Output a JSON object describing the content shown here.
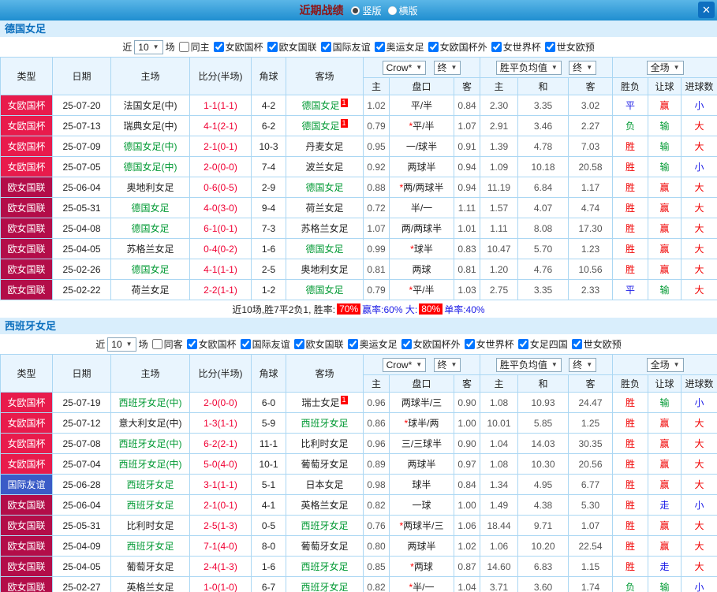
{
  "topbar": {
    "title": "近期战绩",
    "radios": [
      {
        "label": "竖版",
        "selected": true
      },
      {
        "label": "横版",
        "selected": false
      }
    ],
    "close_label": "✕"
  },
  "table_header": {
    "static_cols": [
      "类型",
      "日期",
      "主场",
      "比分(半场)",
      "角球",
      "客场"
    ],
    "odds_group": {
      "select1": "Crow*",
      "select2": "终",
      "cols": [
        "主",
        "盘口",
        "客"
      ]
    },
    "avg_group": {
      "select1": "胜平负均值",
      "select2": "终",
      "cols": [
        "主",
        "和",
        "客"
      ]
    },
    "result_group": {
      "select1": "全场",
      "cols": [
        "胜负",
        "让球",
        "进球数"
      ]
    }
  },
  "colors": {
    "cup": "#e81b4c",
    "nations": "#b30d49",
    "friendly": "#3a5bc7",
    "focal_team": "#009933",
    "score": "#f00033",
    "header_blue": "#0a6ebd"
  },
  "result_colors": {
    "胜": "#f00000",
    "赢": "#f00000",
    "大": "#f00000",
    "平": "#1a1ae6",
    "走": "#1a1ae6",
    "小": "#1a1ae6",
    "负": "#009933",
    "输": "#009933"
  },
  "sections": [
    {
      "team": "德国女足",
      "filter": {
        "prefix": "近",
        "count": "10",
        "suffix": "场",
        "special": {
          "label": "同主",
          "checked": false
        },
        "leagues": [
          {
            "label": "女欧国杯",
            "checked": true
          },
          {
            "label": "欧女国联",
            "checked": true
          },
          {
            "label": "国际友谊",
            "checked": true
          },
          {
            "label": "奥运女足",
            "checked": true
          },
          {
            "label": "女欧国杯外",
            "checked": true
          },
          {
            "label": "女世界杯",
            "checked": true
          },
          {
            "label": "世女欧预",
            "checked": true
          }
        ]
      },
      "rows": [
        {
          "league": "女欧国杯",
          "league_type": "cup",
          "date": "25-07-20",
          "home": "法国女足(中)",
          "home_focal": false,
          "home_badge": "",
          "score": "1-1(1-1)",
          "corners": "4-2",
          "away": "德国女足",
          "away_focal": true,
          "away_badge": "1",
          "odds": [
            "1.02",
            "平/半",
            "0.84"
          ],
          "avg": [
            "2.30",
            "3.35",
            "3.02"
          ],
          "results": [
            "平",
            "赢",
            "小"
          ]
        },
        {
          "league": "女欧国杯",
          "league_type": "cup",
          "date": "25-07-13",
          "home": "瑞典女足(中)",
          "home_focal": false,
          "home_badge": "",
          "score": "4-1(2-1)",
          "corners": "6-2",
          "away": "德国女足",
          "away_focal": true,
          "away_badge": "1",
          "odds": [
            "0.79",
            "*平/半",
            "1.07"
          ],
          "avg": [
            "2.91",
            "3.46",
            "2.27"
          ],
          "results": [
            "负",
            "输",
            "大"
          ]
        },
        {
          "league": "女欧国杯",
          "league_type": "cup",
          "date": "25-07-09",
          "home": "德国女足(中)",
          "home_focal": true,
          "home_badge": "",
          "score": "2-1(0-1)",
          "corners": "10-3",
          "away": "丹麦女足",
          "away_focal": false,
          "away_badge": "",
          "odds": [
            "0.95",
            "一/球半",
            "0.91"
          ],
          "avg": [
            "1.39",
            "4.78",
            "7.03"
          ],
          "results": [
            "胜",
            "输",
            "大"
          ]
        },
        {
          "league": "女欧国杯",
          "league_type": "cup",
          "date": "25-07-05",
          "home": "德国女足(中)",
          "home_focal": true,
          "home_badge": "",
          "score": "2-0(0-0)",
          "corners": "7-4",
          "away": "波兰女足",
          "away_focal": false,
          "away_badge": "",
          "odds": [
            "0.92",
            "两球半",
            "0.94"
          ],
          "avg": [
            "1.09",
            "10.18",
            "20.58"
          ],
          "results": [
            "胜",
            "输",
            "小"
          ]
        },
        {
          "league": "欧女国联",
          "league_type": "nations",
          "date": "25-06-04",
          "home": "奥地利女足",
          "home_focal": false,
          "home_badge": "",
          "score": "0-6(0-5)",
          "corners": "2-9",
          "away": "德国女足",
          "away_focal": true,
          "away_badge": "",
          "odds": [
            "0.88",
            "*两/两球半",
            "0.94"
          ],
          "avg": [
            "11.19",
            "6.84",
            "1.17"
          ],
          "results": [
            "胜",
            "赢",
            "大"
          ]
        },
        {
          "league": "欧女国联",
          "league_type": "nations",
          "date": "25-05-31",
          "home": "德国女足",
          "home_focal": true,
          "home_badge": "",
          "score": "4-0(3-0)",
          "corners": "9-4",
          "away": "荷兰女足",
          "away_focal": false,
          "away_badge": "",
          "odds": [
            "0.72",
            "半/一",
            "1.11"
          ],
          "avg": [
            "1.57",
            "4.07",
            "4.74"
          ],
          "results": [
            "胜",
            "赢",
            "大"
          ]
        },
        {
          "league": "欧女国联",
          "league_type": "nations",
          "date": "25-04-08",
          "home": "德国女足",
          "home_focal": true,
          "home_badge": "",
          "score": "6-1(0-1)",
          "corners": "7-3",
          "away": "苏格兰女足",
          "away_focal": false,
          "away_badge": "",
          "odds": [
            "1.07",
            "两/两球半",
            "1.01"
          ],
          "avg": [
            "1.11",
            "8.08",
            "17.30"
          ],
          "results": [
            "胜",
            "赢",
            "大"
          ]
        },
        {
          "league": "欧女国联",
          "league_type": "nations",
          "date": "25-04-05",
          "home": "苏格兰女足",
          "home_focal": false,
          "home_badge": "",
          "score": "0-4(0-2)",
          "corners": "1-6",
          "away": "德国女足",
          "away_focal": true,
          "away_badge": "",
          "odds": [
            "0.99",
            "*球半",
            "0.83"
          ],
          "avg": [
            "10.47",
            "5.70",
            "1.23"
          ],
          "results": [
            "胜",
            "赢",
            "大"
          ]
        },
        {
          "league": "欧女国联",
          "league_type": "nations",
          "date": "25-02-26",
          "home": "德国女足",
          "home_focal": true,
          "home_badge": "",
          "score": "4-1(1-1)",
          "corners": "2-5",
          "away": "奥地利女足",
          "away_focal": false,
          "away_badge": "",
          "odds": [
            "0.81",
            "两球",
            "0.81"
          ],
          "avg": [
            "1.20",
            "4.76",
            "10.56"
          ],
          "results": [
            "胜",
            "赢",
            "大"
          ]
        },
        {
          "league": "欧女国联",
          "league_type": "nations",
          "date": "25-02-22",
          "home": "荷兰女足",
          "home_focal": false,
          "home_badge": "",
          "score": "2-2(1-1)",
          "corners": "1-2",
          "away": "德国女足",
          "away_focal": true,
          "away_badge": "",
          "odds": [
            "0.79",
            "*平/半",
            "1.03"
          ],
          "avg": [
            "2.75",
            "3.35",
            "2.33"
          ],
          "results": [
            "平",
            "输",
            "大"
          ]
        }
      ],
      "summary": [
        {
          "text": "近10场,胜7平2负1, 胜率: ",
          "style": "plain"
        },
        {
          "text": "70%",
          "style": "badge"
        },
        {
          "text": " 赢率:60% 大: ",
          "style": "blue"
        },
        {
          "text": "80%",
          "style": "badge"
        },
        {
          "text": " 单率:40%",
          "style": "blue"
        }
      ]
    },
    {
      "team": "西班牙女足",
      "filter": {
        "prefix": "近",
        "count": "10",
        "suffix": "场",
        "special": {
          "label": "同客",
          "checked": false
        },
        "leagues": [
          {
            "label": "女欧国杯",
            "checked": true
          },
          {
            "label": "国际友谊",
            "checked": true
          },
          {
            "label": "欧女国联",
            "checked": true
          },
          {
            "label": "奥运女足",
            "checked": true
          },
          {
            "label": "女欧国杯外",
            "checked": true
          },
          {
            "label": "女世界杯",
            "checked": true
          },
          {
            "label": "女足四国",
            "checked": true
          },
          {
            "label": "世女欧预",
            "checked": true
          }
        ]
      },
      "rows": [
        {
          "league": "女欧国杯",
          "league_type": "cup",
          "date": "25-07-19",
          "home": "西班牙女足(中)",
          "home_focal": true,
          "home_badge": "",
          "score": "2-0(0-0)",
          "corners": "6-0",
          "away": "瑞士女足",
          "away_focal": false,
          "away_badge": "1",
          "odds": [
            "0.96",
            "两球半/三",
            "0.90"
          ],
          "avg": [
            "1.08",
            "10.93",
            "24.47"
          ],
          "results": [
            "胜",
            "输",
            "小"
          ]
        },
        {
          "league": "女欧国杯",
          "league_type": "cup",
          "date": "25-07-12",
          "home": "意大利女足(中)",
          "home_focal": false,
          "home_badge": "",
          "score": "1-3(1-1)",
          "corners": "5-9",
          "away": "西班牙女足",
          "away_focal": true,
          "away_badge": "",
          "odds": [
            "0.86",
            "*球半/两",
            "1.00"
          ],
          "avg": [
            "10.01",
            "5.85",
            "1.25"
          ],
          "results": [
            "胜",
            "赢",
            "大"
          ]
        },
        {
          "league": "女欧国杯",
          "league_type": "cup",
          "date": "25-07-08",
          "home": "西班牙女足(中)",
          "home_focal": true,
          "home_badge": "",
          "score": "6-2(2-1)",
          "corners": "11-1",
          "away": "比利时女足",
          "away_focal": false,
          "away_badge": "",
          "odds": [
            "0.96",
            "三/三球半",
            "0.90"
          ],
          "avg": [
            "1.04",
            "14.03",
            "30.35"
          ],
          "results": [
            "胜",
            "赢",
            "大"
          ]
        },
        {
          "league": "女欧国杯",
          "league_type": "cup",
          "date": "25-07-04",
          "home": "西班牙女足(中)",
          "home_focal": true,
          "home_badge": "",
          "score": "5-0(4-0)",
          "corners": "10-1",
          "away": "葡萄牙女足",
          "away_focal": false,
          "away_badge": "",
          "odds": [
            "0.89",
            "两球半",
            "0.97"
          ],
          "avg": [
            "1.08",
            "10.30",
            "20.56"
          ],
          "results": [
            "胜",
            "赢",
            "大"
          ]
        },
        {
          "league": "国际友谊",
          "league_type": "friendly",
          "date": "25-06-28",
          "home": "西班牙女足",
          "home_focal": true,
          "home_badge": "",
          "score": "3-1(1-1)",
          "corners": "5-1",
          "away": "日本女足",
          "away_focal": false,
          "away_badge": "",
          "odds": [
            "0.98",
            "球半",
            "0.84"
          ],
          "avg": [
            "1.34",
            "4.95",
            "6.77"
          ],
          "results": [
            "胜",
            "赢",
            "大"
          ]
        },
        {
          "league": "欧女国联",
          "league_type": "nations",
          "date": "25-06-04",
          "home": "西班牙女足",
          "home_focal": true,
          "home_badge": "",
          "score": "2-1(0-1)",
          "corners": "4-1",
          "away": "英格兰女足",
          "away_focal": false,
          "away_badge": "",
          "odds": [
            "0.82",
            "一球",
            "1.00"
          ],
          "avg": [
            "1.49",
            "4.38",
            "5.30"
          ],
          "results": [
            "胜",
            "走",
            "小"
          ]
        },
        {
          "league": "欧女国联",
          "league_type": "nations",
          "date": "25-05-31",
          "home": "比利时女足",
          "home_focal": false,
          "home_badge": "",
          "score": "2-5(1-3)",
          "corners": "0-5",
          "away": "西班牙女足",
          "away_focal": true,
          "away_badge": "",
          "odds": [
            "0.76",
            "*两球半/三",
            "1.06"
          ],
          "avg": [
            "18.44",
            "9.71",
            "1.07"
          ],
          "results": [
            "胜",
            "赢",
            "大"
          ]
        },
        {
          "league": "欧女国联",
          "league_type": "nations",
          "date": "25-04-09",
          "home": "西班牙女足",
          "home_focal": true,
          "home_badge": "",
          "score": "7-1(4-0)",
          "corners": "8-0",
          "away": "葡萄牙女足",
          "away_focal": false,
          "away_badge": "",
          "odds": [
            "0.80",
            "两球半",
            "1.02"
          ],
          "avg": [
            "1.06",
            "10.20",
            "22.54"
          ],
          "results": [
            "胜",
            "赢",
            "大"
          ]
        },
        {
          "league": "欧女国联",
          "league_type": "nations",
          "date": "25-04-05",
          "home": "葡萄牙女足",
          "home_focal": false,
          "home_badge": "",
          "score": "2-4(1-3)",
          "corners": "1-6",
          "away": "西班牙女足",
          "away_focal": true,
          "away_badge": "",
          "odds": [
            "0.85",
            "*两球",
            "0.87"
          ],
          "avg": [
            "14.60",
            "6.83",
            "1.15"
          ],
          "results": [
            "胜",
            "走",
            "大"
          ]
        },
        {
          "league": "欧女国联",
          "league_type": "nations",
          "date": "25-02-27",
          "home": "英格兰女足",
          "home_focal": false,
          "home_badge": "",
          "score": "1-0(1-0)",
          "corners": "6-7",
          "away": "西班牙女足",
          "away_focal": true,
          "away_badge": "",
          "odds": [
            "0.82",
            "*半/一",
            "1.04"
          ],
          "avg": [
            "3.71",
            "3.60",
            "1.74"
          ],
          "results": [
            "负",
            "输",
            "小"
          ]
        }
      ],
      "summary": []
    }
  ]
}
